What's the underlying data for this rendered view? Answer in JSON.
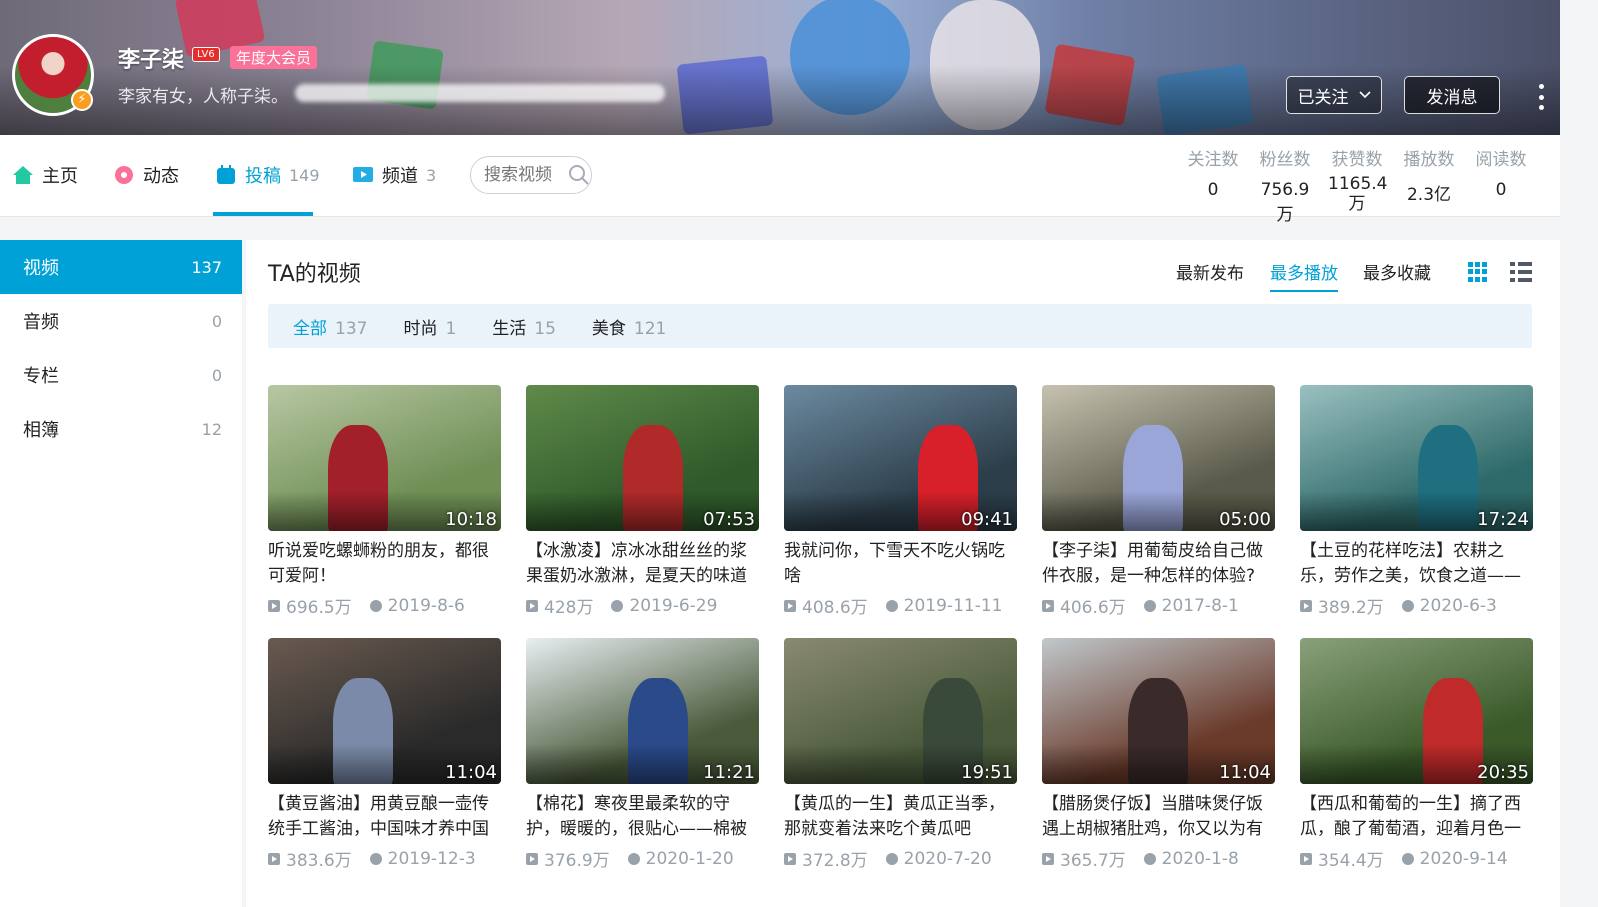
{
  "header": {
    "username": "李子柒",
    "level_badge": "LV6",
    "vip_label": "年度大会员",
    "signature": "李家有女，人称子柒。",
    "follow_button": "已关注",
    "message_button": "发消息"
  },
  "nav": {
    "home": "主页",
    "dynamic": "动态",
    "videos": "投稿",
    "videos_count": "149",
    "channels": "频道",
    "channels_count": "3",
    "search_placeholder": "搜索视频"
  },
  "stats": [
    {
      "label": "关注数",
      "value": "0"
    },
    {
      "label": "粉丝数",
      "value": "756.9万"
    },
    {
      "label": "获赞数",
      "value": "1165.4万"
    },
    {
      "label": "播放数",
      "value": "2.3亿"
    },
    {
      "label": "阅读数",
      "value": "0"
    }
  ],
  "sidebar": [
    {
      "label": "视频",
      "count": "137"
    },
    {
      "label": "音频",
      "count": "0"
    },
    {
      "label": "专栏",
      "count": "0"
    },
    {
      "label": "相簿",
      "count": "12"
    }
  ],
  "main": {
    "title": "TA的视频",
    "sort": [
      "最新发布",
      "最多播放",
      "最多收藏"
    ],
    "filters": [
      {
        "label": "全部",
        "count": "137"
      },
      {
        "label": "时尚",
        "count": "1"
      },
      {
        "label": "生活",
        "count": "15"
      },
      {
        "label": "美食",
        "count": "121"
      }
    ]
  },
  "videos": [
    {
      "title": "听说爱吃螺蛳粉的朋友，都很可爱阿！",
      "duration": "10:18",
      "plays": "696.5万",
      "date": "2019-8-6",
      "c1": "#6f8f55",
      "c2": "#b8c7a3",
      "fig": "#a2202a"
    },
    {
      "title": "【冰激凌】凉冰冰甜丝丝的浆果蛋奶冰激淋，是夏天的味道",
      "duration": "07:53",
      "plays": "428万",
      "date": "2019-6-29",
      "c1": "#2f5a2a",
      "c2": "#5f8a4a",
      "fig": "#b12a2a"
    },
    {
      "title": "我就问你，下雪天不吃火锅吃啥",
      "duration": "09:41",
      "plays": "408.6万",
      "date": "2019-11-11",
      "c1": "#2c3e4a",
      "c2": "#6c8aa0",
      "fig": "#d8202a"
    },
    {
      "title": "【李子柒】用葡萄皮给自己做件衣服，是一种怎样的体验?",
      "duration": "05:00",
      "plays": "406.6万",
      "date": "2017-8-1",
      "c1": "#5a5a4a",
      "c2": "#c7c2b0",
      "fig": "#9aa5d8"
    },
    {
      "title": "【土豆的花样吃法】农耕之乐，劳作之美，饮食之道——",
      "duration": "17:24",
      "plays": "389.2万",
      "date": "2020-6-3",
      "c1": "#2f6a6a",
      "c2": "#9ac0c0",
      "fig": "#1f6f80"
    },
    {
      "title": "【黄豆酱油】用黄豆酿一壶传统手工酱油，中国味才养中国",
      "duration": "11:04",
      "plays": "383.6万",
      "date": "2019-12-3",
      "c1": "#2a2a2a",
      "c2": "#6a5a50",
      "fig": "#7a8aa8"
    },
    {
      "title": "【棉花】寒夜里最柔软的守护，暖暖的，很贴心——棉被",
      "duration": "11:21",
      "plays": "376.9万",
      "date": "2020-1-20",
      "c1": "#4a5a3a",
      "c2": "#e8eef2",
      "fig": "#2a4a8a"
    },
    {
      "title": "【黄瓜的一生】黄瓜正当季，那就变着法来吃个黄瓜吧",
      "duration": "19:51",
      "plays": "372.8万",
      "date": "2020-7-20",
      "c1": "#4a5a3a",
      "c2": "#8a8a70",
      "fig": "#3a4a3a"
    },
    {
      "title": "【腊肠煲仔饭】当腊味煲仔饭遇上胡椒猪肚鸡，你又以为有",
      "duration": "11:04",
      "plays": "365.7万",
      "date": "2020-1-8",
      "c1": "#6a3a2a",
      "c2": "#c0c8cc",
      "fig": "#3a2a2a"
    },
    {
      "title": "【西瓜和葡萄的一生】摘了西瓜，酿了葡萄酒，迎着月色一",
      "duration": "20:35",
      "plays": "354.4万",
      "date": "2020-9-14",
      "c1": "#3a5a2a",
      "c2": "#8aa07a",
      "fig": "#c02a2a"
    }
  ]
}
